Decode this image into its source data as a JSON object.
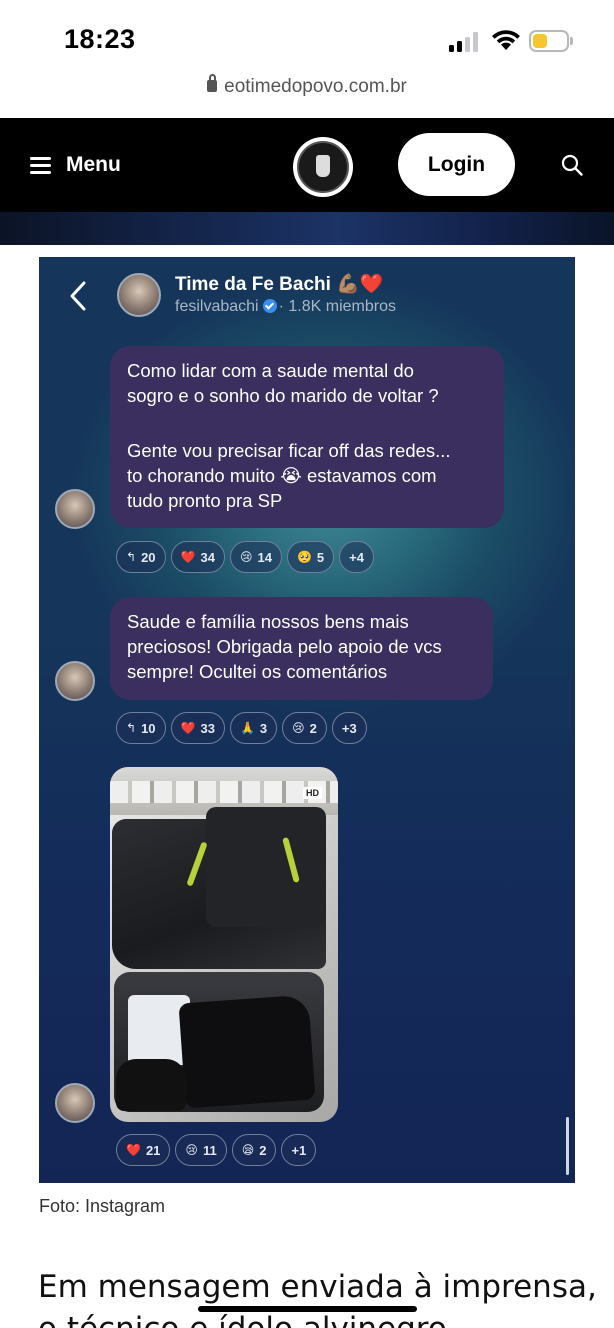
{
  "status_bar": {
    "time": "18:23",
    "signal_bars_filled": 2,
    "signal_bars_total": 4,
    "wifi_icon": "wifi-icon",
    "battery_level": 0.35,
    "battery_color": "#f6c62a"
  },
  "url_bar": {
    "lock_icon": "lock-icon",
    "url": "eotimedopovo.com.br"
  },
  "site_header": {
    "menu_label": "Menu",
    "menu_icon": "hamburger-icon",
    "logo_icon": "site-logo",
    "login_label": "Login",
    "search_icon": "search-icon",
    "background": "#000000"
  },
  "chat": {
    "title": "Time da Fe Bachi 💪🏽❤️",
    "handle": "fesilvabachi",
    "members": "· 1.8K miembros",
    "messages": [
      {
        "text_lines": [
          "Como lidar com a saude mental do",
          "sogro e o sonho do marido de voltar ?",
          "",
          "Gente vou precisar ficar off das redes...",
          "to chorando muito 😭 estavamos com",
          "tudo pronto pra SP"
        ],
        "reactions": [
          {
            "emoji": "↰",
            "count": "20"
          },
          {
            "emoji": "❤️",
            "count": "34"
          },
          {
            "emoji": "😢",
            "count": "14"
          },
          {
            "emoji": "🥺",
            "count": "5"
          },
          {
            "emoji": "",
            "count": "+4"
          }
        ]
      },
      {
        "text_lines": [
          "Saude e família nossos bens mais",
          "preciosos! Obrigada pelo apoio de vcs",
          "sempre! Ocultei os comentários"
        ],
        "reactions": [
          {
            "emoji": "↰",
            "count": "10"
          },
          {
            "emoji": "❤️",
            "count": "33"
          },
          {
            "emoji": "🙏",
            "count": "3"
          },
          {
            "emoji": "😢",
            "count": "2"
          },
          {
            "emoji": "",
            "count": "+3"
          }
        ]
      },
      {
        "photo_badge": "HD",
        "reactions": [
          {
            "emoji": "❤️",
            "count": "21"
          },
          {
            "emoji": "😢",
            "count": "11"
          },
          {
            "emoji": "😪",
            "count": "2"
          },
          {
            "emoji": "",
            "count": "+1"
          }
        ]
      }
    ]
  },
  "caption": "Foto: Instagram",
  "article_text": "Em mensagem enviada à imprensa, o técnico e ídolo alvinegro confirmou a"
}
